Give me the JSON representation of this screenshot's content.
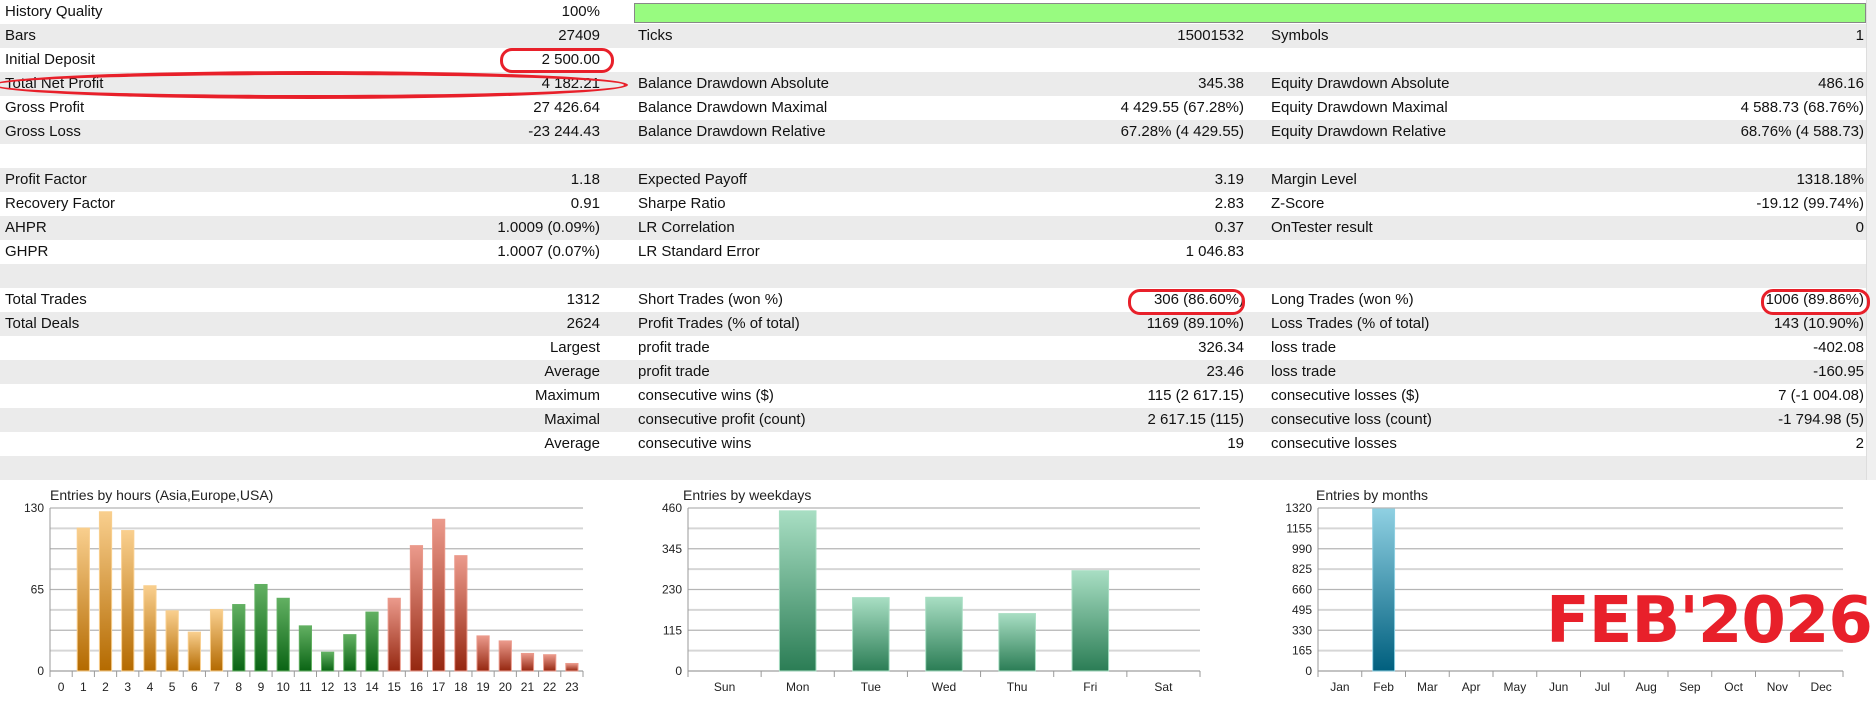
{
  "report": {
    "history_quality_fill": 1.0,
    "rows": [
      {
        "l1": "History Quality",
        "v1": "100%",
        "l2": "",
        "v2": "",
        "l3": "",
        "v3": ""
      },
      {
        "l1": "Bars",
        "v1": "27409",
        "l2": "Ticks",
        "v2": "15001532",
        "l3": "Symbols",
        "v3": "1"
      },
      {
        "l1": "Initial Deposit",
        "v1": "2 500.00",
        "l2": "",
        "v2": "",
        "l3": "",
        "v3": ""
      },
      {
        "l1": "Total Net Profit",
        "v1": "4 182.21",
        "l2": "Balance Drawdown Absolute",
        "v2": "345.38",
        "l3": "Equity Drawdown Absolute",
        "v3": "486.16"
      },
      {
        "l1": "Gross Profit",
        "v1": "27 426.64",
        "l2": "Balance Drawdown Maximal",
        "v2": "4 429.55 (67.28%)",
        "l3": "Equity Drawdown Maximal",
        "v3": "4 588.73 (68.76%)"
      },
      {
        "l1": "Gross Loss",
        "v1": "-23 244.43",
        "l2": "Balance Drawdown Relative",
        "v2": "67.28% (4 429.55)",
        "l3": "Equity Drawdown Relative",
        "v3": "68.76% (4 588.73)"
      },
      {
        "l1": "",
        "v1": "",
        "l2": "",
        "v2": "",
        "l3": "",
        "v3": ""
      },
      {
        "l1": "Profit Factor",
        "v1": "1.18",
        "l2": "Expected Payoff",
        "v2": "3.19",
        "l3": "Margin Level",
        "v3": "1318.18%"
      },
      {
        "l1": "Recovery Factor",
        "v1": "0.91",
        "l2": "Sharpe Ratio",
        "v2": "2.83",
        "l3": "Z-Score",
        "v3": "-19.12 (99.74%)"
      },
      {
        "l1": "AHPR",
        "v1": "1.0009 (0.09%)",
        "l2": "LR Correlation",
        "v2": "0.37",
        "l3": "OnTester result",
        "v3": "0"
      },
      {
        "l1": "GHPR",
        "v1": "1.0007 (0.07%)",
        "l2": "LR Standard Error",
        "v2": "1 046.83",
        "l3": "",
        "v3": ""
      },
      {
        "l1": "",
        "v1": "",
        "l2": "",
        "v2": "",
        "l3": "",
        "v3": ""
      },
      {
        "l1": "Total Trades",
        "v1": "1312",
        "l2": "Short Trades (won %)",
        "v2": "306 (86.60%)",
        "l3": "Long Trades (won %)",
        "v3": "1006 (89.86%)"
      },
      {
        "l1": "Total Deals",
        "v1": "2624",
        "l2": "Profit Trades (% of total)",
        "v2": "1169 (89.10%)",
        "l3": "Loss Trades (% of total)",
        "v3": "143 (10.90%)"
      },
      {
        "l1": "",
        "v1": "Largest",
        "l2": "profit trade",
        "v2": "326.34",
        "l3": "loss trade",
        "v3": "-402.08"
      },
      {
        "l1": "",
        "v1": "Average",
        "l2": "profit trade",
        "v2": "23.46",
        "l3": "loss trade",
        "v3": "-160.95"
      },
      {
        "l1": "",
        "v1": "Maximum",
        "l2": "consecutive wins ($)",
        "v2": "115 (2 617.15)",
        "l3": "consecutive losses ($)",
        "v3": "7 (-1 004.08)"
      },
      {
        "l1": "",
        "v1": "Maximal",
        "l2": "consecutive profit (count)",
        "v2": "2 617.15 (115)",
        "l3": "consecutive loss (count)",
        "v3": "-1 794.98 (5)"
      },
      {
        "l1": "",
        "v1": "Average",
        "l2": "consecutive wins",
        "v2": "19",
        "l3": "consecutive losses",
        "v3": "2"
      },
      {
        "l1": "",
        "v1": "",
        "l2": "",
        "v2": "",
        "l3": "",
        "v3": ""
      }
    ]
  },
  "annotation": {
    "text": "FEB'2026",
    "color": "#e8202a"
  },
  "chart_data": [
    {
      "type": "bar",
      "title": "Entries by hours (Asia,Europe,USA)",
      "categories": [
        "0",
        "1",
        "2",
        "3",
        "4",
        "5",
        "6",
        "7",
        "8",
        "9",
        "10",
        "11",
        "12",
        "13",
        "14",
        "15",
        "16",
        "17",
        "18",
        "19",
        "20",
        "21",
        "22",
        "23"
      ],
      "values": [
        0,
        114,
        127,
        112,
        68,
        48,
        31,
        49,
        53,
        69,
        58,
        36,
        15,
        29,
        47,
        58,
        100,
        121,
        92,
        28,
        24,
        14,
        13,
        6
      ],
      "ylim": [
        0,
        130
      ],
      "yticks": [
        "130",
        "65",
        "0"
      ],
      "grid": true,
      "color_groups": [
        {
          "from": 0,
          "to": 7,
          "top": "#f9cf8e",
          "bottom": "#b46a00"
        },
        {
          "from": 8,
          "to": 14,
          "top": "#62b062",
          "bottom": "#0a6414"
        },
        {
          "from": 15,
          "to": 23,
          "top": "#eb9a8c",
          "bottom": "#952710"
        }
      ]
    },
    {
      "type": "bar",
      "title": "Entries by weekdays",
      "categories": [
        "Sun",
        "Mon",
        "Tue",
        "Wed",
        "Thu",
        "Fri",
        "Sat"
      ],
      "values": [
        0,
        452,
        207,
        208,
        162,
        283,
        0
      ],
      "ylim": [
        0,
        460
      ],
      "yticks": [
        "460",
        "345",
        "230",
        "115",
        "0"
      ],
      "grid": true,
      "color_groups": [
        {
          "from": 0,
          "to": 6,
          "top": "#a8dec3",
          "bottom": "#2b7d55"
        }
      ]
    },
    {
      "type": "bar",
      "title": "Entries by months",
      "categories": [
        "Jan",
        "Feb",
        "Mar",
        "Apr",
        "May",
        "Jun",
        "Jul",
        "Aug",
        "Sep",
        "Oct",
        "Nov",
        "Dec"
      ],
      "values": [
        0,
        1312,
        0,
        0,
        0,
        0,
        0,
        0,
        0,
        0,
        0,
        0
      ],
      "ylim": [
        0,
        1320
      ],
      "yticks": [
        "1320",
        "1155",
        "990",
        "825",
        "660",
        "495",
        "330",
        "165",
        "0"
      ],
      "grid": true,
      "color_groups": [
        {
          "from": 0,
          "to": 11,
          "top": "#8fd0e2",
          "bottom": "#005f7e"
        }
      ]
    }
  ]
}
